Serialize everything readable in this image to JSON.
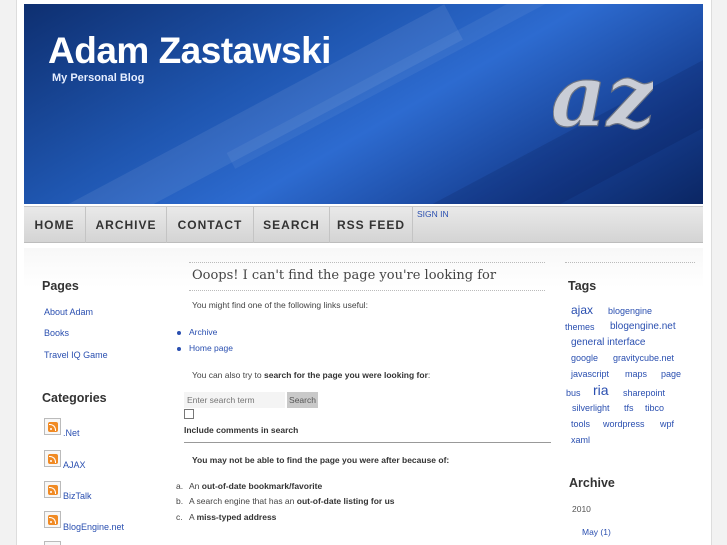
{
  "header": {
    "title": "Adam Zastawski",
    "subtitle": "My Personal Blog",
    "logo_text": "az"
  },
  "nav": {
    "items": [
      {
        "label": "HOME"
      },
      {
        "label": "ARCHIVE"
      },
      {
        "label": "CONTACT"
      },
      {
        "label": "SEARCH"
      },
      {
        "label": "RSS FEED"
      }
    ],
    "signin": "SIGN IN"
  },
  "sidebar_left": {
    "pages_heading": "Pages",
    "pages": [
      "About Adam",
      "Books",
      "Travel IQ Game"
    ],
    "categories_heading": "Categories",
    "categories": [
      ".Net",
      "AJAX",
      "BizTalk",
      "BlogEngine.net"
    ]
  },
  "main": {
    "title": "Ooops! I can't find the page you're looking for",
    "intro": "You might find one of the following links useful:",
    "links": [
      "Archive",
      "Home page"
    ],
    "search_prompt_prefix": "You can also try to ",
    "search_prompt_bold": "search for the page you were looking for",
    "search_prompt_suffix": ":",
    "search_placeholder": "Enter search term",
    "search_button": "Search",
    "include_comments": "Include comments in search",
    "reason_heading": "You may not be able to find the page you were after because of:",
    "reasons": [
      {
        "marker": "a.",
        "prefix": "An ",
        "bold": "out-of-date bookmark/favorite",
        "suffix": ""
      },
      {
        "marker": "b.",
        "prefix": "A search engine that has an ",
        "bold": "out-of-date listing for us",
        "suffix": ""
      },
      {
        "marker": "c.",
        "prefix": "A ",
        "bold": "miss-typed address",
        "suffix": ""
      }
    ]
  },
  "sidebar_right": {
    "tags_heading": "Tags",
    "tags": [
      "ajax",
      "blogengine",
      "themes",
      "blogengine.net",
      "general interface",
      "google",
      "gravitycube.net",
      "javascript",
      "maps",
      "page",
      "bus",
      "ria",
      "sharepoint",
      "silverlight",
      "tfs",
      "tibco",
      "tools",
      "wordpress",
      "wpf",
      "xaml"
    ],
    "archive_heading": "Archive",
    "archive_year": "2010",
    "archive_month": "May (1)"
  },
  "colors": {
    "link": "#2a4fb0",
    "header_blue": "#1f56b0",
    "rss_orange": "#f08a24"
  }
}
